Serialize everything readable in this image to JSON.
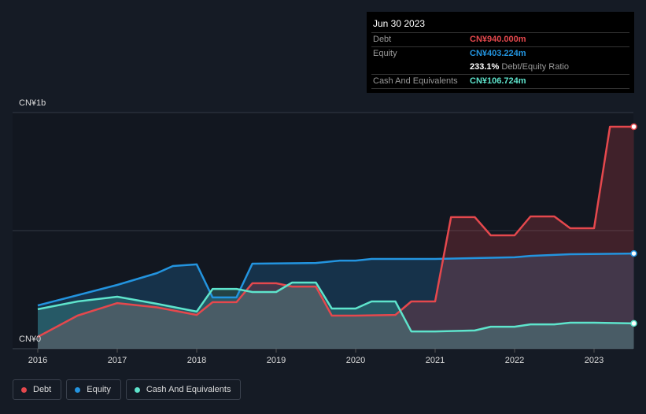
{
  "tooltip": {
    "date": "Jun 30 2023",
    "debt_label": "Debt",
    "debt_value": "CN¥940.000m",
    "equity_label": "Equity",
    "equity_value": "CN¥403.224m",
    "ratio_value": "233.1%",
    "ratio_label": "Debt/Equity Ratio",
    "cash_label": "Cash And Equivalents",
    "cash_value": "CN¥106.724m"
  },
  "legend": [
    {
      "label": "Debt"
    },
    {
      "label": "Equity"
    },
    {
      "label": "Cash And Equivalents"
    }
  ],
  "chart_data": {
    "type": "area",
    "title": "",
    "ylabel": "",
    "xlabel": "",
    "y_tick_labels": [
      "CN¥0",
      "CN¥1b"
    ],
    "ylim": [
      0,
      1000
    ],
    "xlim": [
      2015.7,
      2023.5
    ],
    "x_tick_labels": [
      "2016",
      "2017",
      "2018",
      "2019",
      "2020",
      "2021",
      "2022",
      "2023"
    ],
    "colors": {
      "Debt": "#e5484d",
      "Equity": "#2394df",
      "Cash And Equivalents": "#5ee4cc"
    },
    "series": [
      {
        "name": "Debt",
        "points": [
          [
            2016,
            50
          ],
          [
            2016.5,
            140
          ],
          [
            2017,
            193
          ],
          [
            2017.5,
            175
          ],
          [
            2018,
            143
          ],
          [
            2018.2,
            197
          ],
          [
            2018.5,
            197
          ],
          [
            2018.7,
            277
          ],
          [
            2019,
            277
          ],
          [
            2019.2,
            263
          ],
          [
            2019.5,
            263
          ],
          [
            2019.7,
            140
          ],
          [
            2020,
            140
          ],
          [
            2020.5,
            143
          ],
          [
            2020.7,
            200
          ],
          [
            2021,
            200
          ],
          [
            2021.2,
            557
          ],
          [
            2021.5,
            557
          ],
          [
            2021.7,
            480
          ],
          [
            2022,
            480
          ],
          [
            2022.2,
            560
          ],
          [
            2022.5,
            560
          ],
          [
            2022.7,
            510
          ],
          [
            2023,
            510
          ],
          [
            2023.2,
            940
          ],
          [
            2023.5,
            940
          ]
        ]
      },
      {
        "name": "Equity",
        "points": [
          [
            2016,
            183
          ],
          [
            2017,
            270
          ],
          [
            2017.5,
            320
          ],
          [
            2017.7,
            350
          ],
          [
            2018,
            357
          ],
          [
            2018.2,
            217
          ],
          [
            2018.5,
            217
          ],
          [
            2018.7,
            360
          ],
          [
            2019.5,
            363
          ],
          [
            2019.8,
            373
          ],
          [
            2020,
            373
          ],
          [
            2020.2,
            380
          ],
          [
            2021,
            380
          ],
          [
            2022,
            387
          ],
          [
            2022.2,
            393
          ],
          [
            2022.7,
            400
          ],
          [
            2023.5,
            403
          ]
        ]
      },
      {
        "name": "Cash And Equivalents",
        "points": [
          [
            2016,
            167
          ],
          [
            2016.5,
            200
          ],
          [
            2017,
            220
          ],
          [
            2017.5,
            190
          ],
          [
            2018,
            157
          ],
          [
            2018.2,
            253
          ],
          [
            2018.5,
            253
          ],
          [
            2018.7,
            240
          ],
          [
            2019,
            240
          ],
          [
            2019.2,
            280
          ],
          [
            2019.5,
            280
          ],
          [
            2019.7,
            170
          ],
          [
            2020,
            170
          ],
          [
            2020.2,
            200
          ],
          [
            2020.5,
            200
          ],
          [
            2020.7,
            73
          ],
          [
            2021,
            73
          ],
          [
            2021.5,
            77
          ],
          [
            2021.7,
            93
          ],
          [
            2022,
            93
          ],
          [
            2022.2,
            103
          ],
          [
            2022.5,
            103
          ],
          [
            2022.7,
            110
          ],
          [
            2023,
            110
          ],
          [
            2023.5,
            107
          ]
        ]
      }
    ]
  }
}
